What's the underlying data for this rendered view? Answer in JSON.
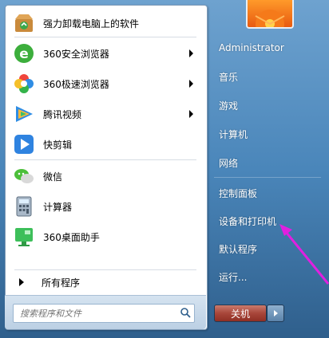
{
  "programs": [
    {
      "label": "强力卸载电脑上的软件",
      "icon": "uninstall-box-icon",
      "has_submenu": false
    },
    {
      "label": "360安全浏览器",
      "icon": "360-safe-browser-icon",
      "has_submenu": true
    },
    {
      "label": "360极速浏览器",
      "icon": "360-speed-browser-icon",
      "has_submenu": true
    },
    {
      "label": "腾讯视频",
      "icon": "tencent-video-icon",
      "has_submenu": true
    },
    {
      "label": "快剪辑",
      "icon": "kuaijianji-icon",
      "has_submenu": false
    },
    {
      "label": "微信",
      "icon": "wechat-icon",
      "has_submenu": false
    },
    {
      "label": "计算器",
      "icon": "calculator-icon",
      "has_submenu": false
    },
    {
      "label": "360桌面助手",
      "icon": "360-desktop-assistant-icon",
      "has_submenu": false
    }
  ],
  "all_programs_label": "所有程序",
  "search": {
    "placeholder": "搜索程序和文件"
  },
  "right_pane": {
    "items": [
      {
        "label": "Administrator"
      },
      {
        "label": "音乐"
      },
      {
        "label": "游戏"
      },
      {
        "label": "计算机"
      },
      {
        "label": "网络"
      },
      {
        "label": "控制面板"
      },
      {
        "label": "设备和打印机"
      },
      {
        "label": "默认程序"
      },
      {
        "label": "运行..."
      }
    ]
  },
  "shutdown": {
    "label": "关机"
  },
  "colors": {
    "annotation_arrow": "#e020e0",
    "shutdown_red": "#a8463a"
  }
}
